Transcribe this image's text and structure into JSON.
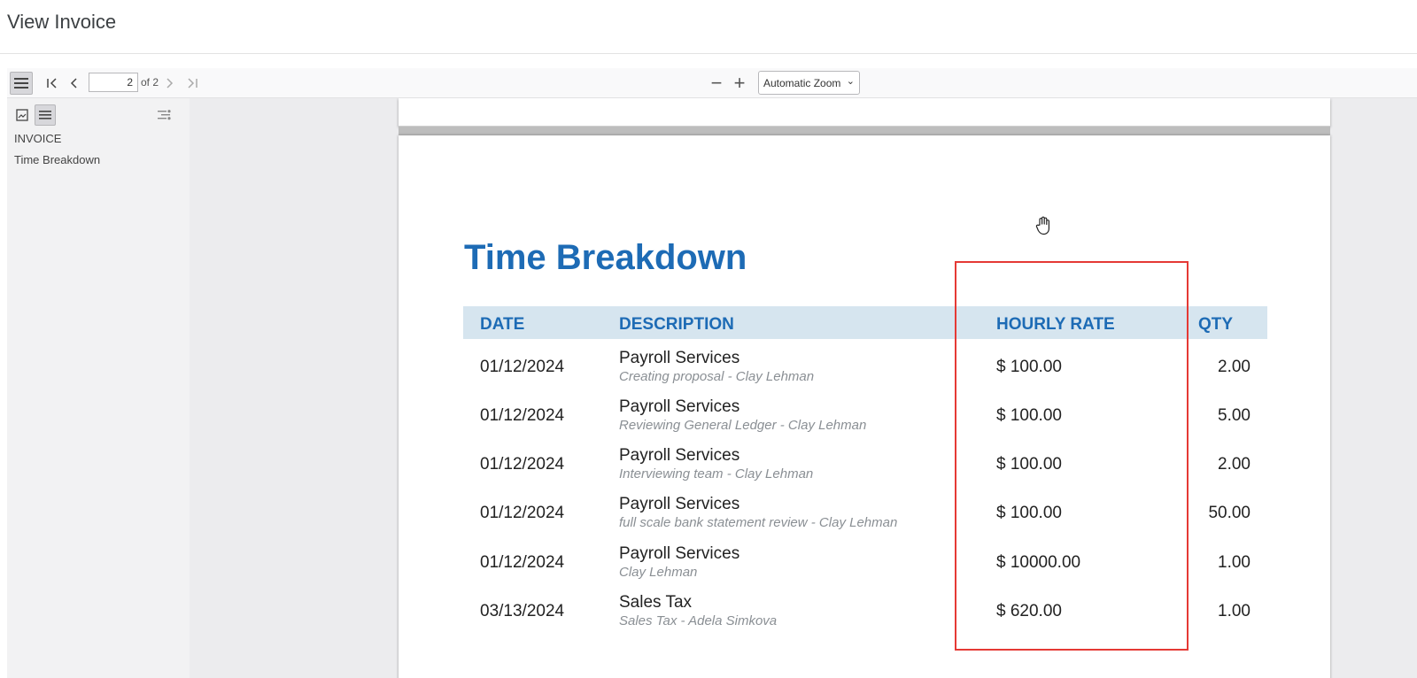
{
  "header": {
    "title": "View Invoice"
  },
  "toolbar": {
    "page_number": "2",
    "page_of": "of 2",
    "zoom_selected": "Automatic Zoom",
    "zoom_out": "−",
    "zoom_in": "+",
    "first_page": "I<",
    "prev_page": "<",
    "next_page": ">",
    "last_page": ">I"
  },
  "sidebar": {
    "outline": [
      {
        "label": "INVOICE"
      },
      {
        "label": "Time Breakdown"
      }
    ]
  },
  "document": {
    "title": "Time Breakdown",
    "columns": {
      "date": "DATE",
      "description": "DESCRIPTION",
      "rate": "HOURLY RATE",
      "qty": "QTY"
    },
    "rows": [
      {
        "date": "01/12/2024",
        "service": "Payroll Services",
        "detail": "Creating proposal - Clay Lehman",
        "rate": "$ 100.00",
        "qty": "2.00"
      },
      {
        "date": "01/12/2024",
        "service": "Payroll Services",
        "detail": "Reviewing General Ledger - Clay Lehman",
        "rate": "$ 100.00",
        "qty": "5.00"
      },
      {
        "date": "01/12/2024",
        "service": "Payroll Services",
        "detail": "Interviewing team - Clay Lehman",
        "rate": "$ 100.00",
        "qty": "2.00"
      },
      {
        "date": "01/12/2024",
        "service": "Payroll Services",
        "detail": "full scale bank statement review - Clay Lehman",
        "rate": "$ 100.00",
        "qty": "50.00"
      },
      {
        "date": "01/12/2024",
        "service": "Payroll Services",
        "detail": "Clay Lehman",
        "rate": "$ 10000.00",
        "qty": "1.00"
      },
      {
        "date": "03/13/2024",
        "service": "Sales Tax",
        "detail": "Sales Tax - Adela Simkova",
        "rate": "$ 620.00",
        "qty": "1.00"
      }
    ]
  },
  "colors": {
    "accent": "#1d6bb5",
    "table_header_bg": "#d6e5ef",
    "highlight": "#e53935"
  }
}
